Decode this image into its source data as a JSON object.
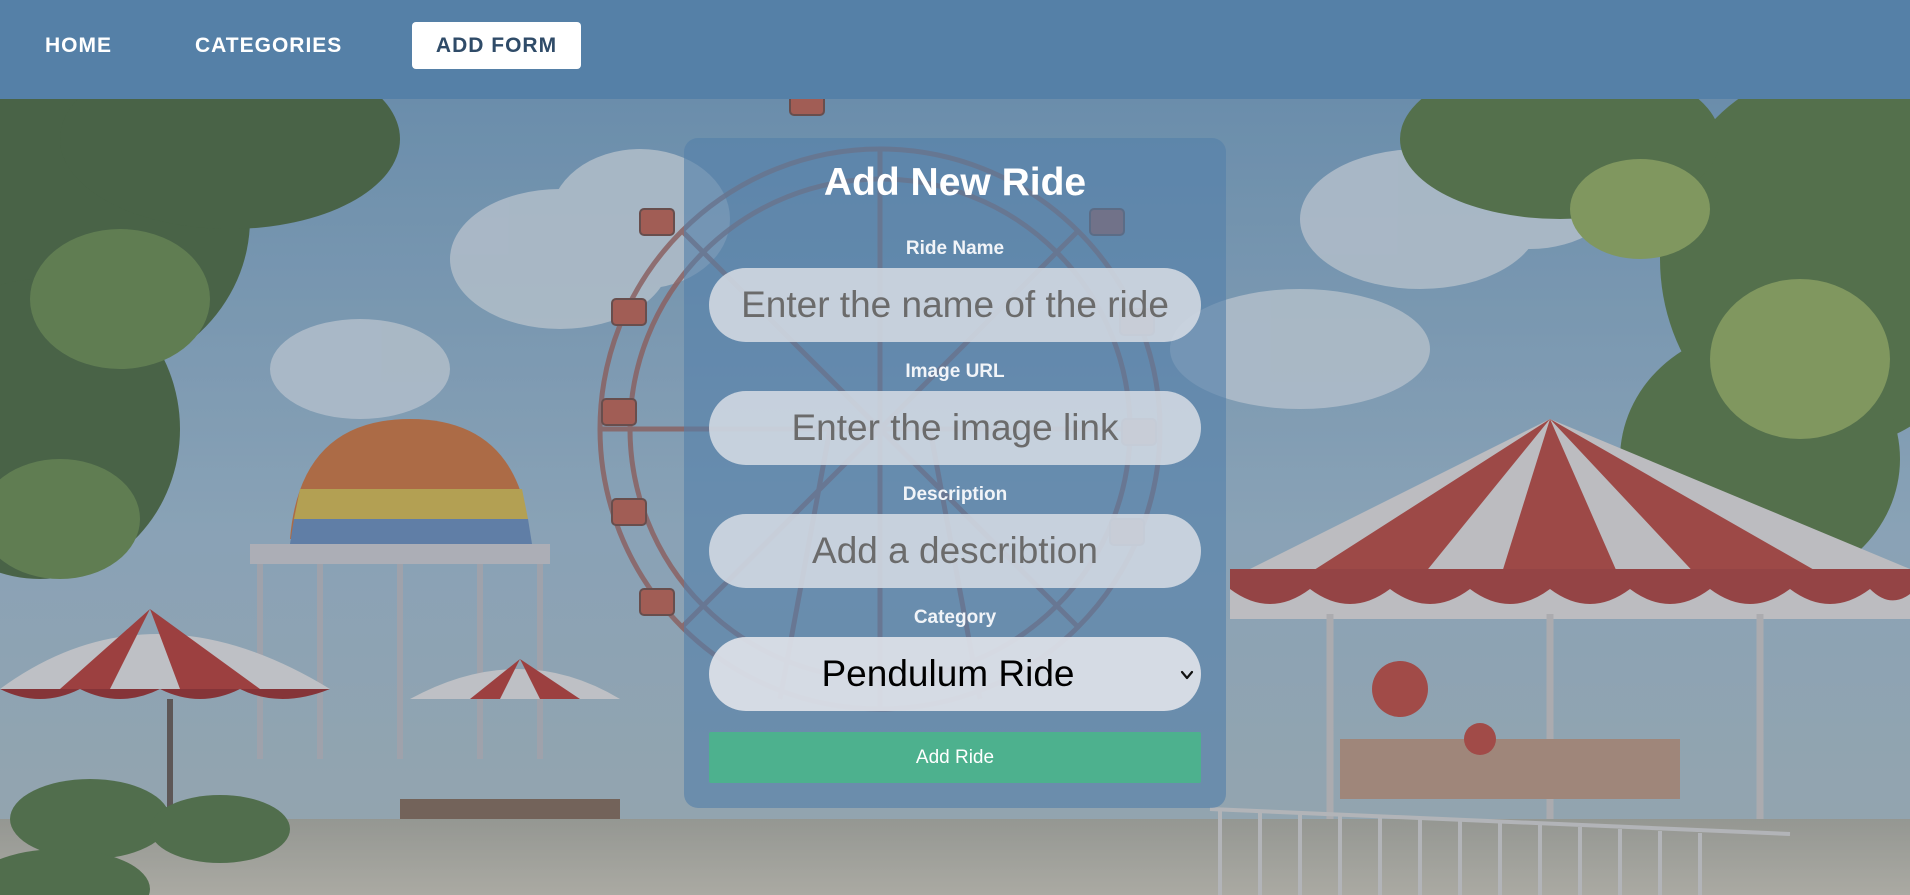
{
  "nav": {
    "home": "HOME",
    "categories": "CATEGORIES",
    "add_form": "ADD FORM"
  },
  "form": {
    "title": "Add New Ride",
    "ride_name": {
      "label": "Ride Name",
      "placeholder": "Enter the name of the ride",
      "value": ""
    },
    "image_url": {
      "label": "Image URL",
      "placeholder": "Enter the image link",
      "value": ""
    },
    "description": {
      "label": "Description",
      "placeholder": "Add a describtion",
      "value": ""
    },
    "category": {
      "label": "Category",
      "selected": "Pendulum Ride"
    },
    "submit_label": "Add Ride"
  },
  "colors": {
    "navbar": "#5580a7",
    "active_nav_bg": "#ffffff",
    "submit_button": "#4db18e",
    "card_overlay": "rgba(84,128,170,0.62)"
  },
  "icons": {
    "select_arrow": "chevron-down-icon"
  }
}
